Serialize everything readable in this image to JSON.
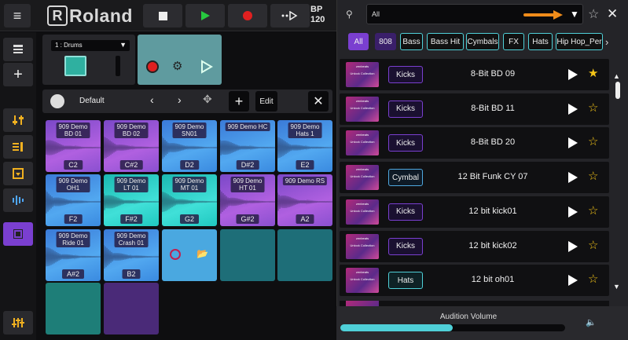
{
  "header": {
    "logo_text": "Roland",
    "logo_mark": "R",
    "bpm_label": "BP",
    "bpm_value": "120"
  },
  "strip": {
    "dropdown_value": "1 : Drums"
  },
  "kit": {
    "name": "Default",
    "edit_label": "Edit"
  },
  "pads": [
    {
      "label": [
        "909 Demo",
        "BD 01"
      ],
      "note": "C2",
      "color": "purple"
    },
    {
      "label": [
        "909 Demo",
        "BD 02"
      ],
      "note": "C#2",
      "color": "purple"
    },
    {
      "label": [
        "909 Demo",
        "SN01"
      ],
      "note": "D2",
      "color": "blue"
    },
    {
      "label": [
        "909 Demo HC"
      ],
      "note": "D#2",
      "color": "blue"
    },
    {
      "label": [
        "909 Demo",
        "Hats 1"
      ],
      "note": "E2",
      "color": "blue"
    },
    {
      "label": [
        "909 Demo",
        "OH1"
      ],
      "note": "F2",
      "color": "blue"
    },
    {
      "label": [
        "909 Demo",
        "LT 01"
      ],
      "note": "F#2",
      "color": "teal"
    },
    {
      "label": [
        "909 Demo",
        "MT 01"
      ],
      "note": "G2",
      "color": "teal"
    },
    {
      "label": [
        "909 Demo",
        "HT 01"
      ],
      "note": "G#2",
      "color": "purple"
    },
    {
      "label": [
        "909 Demo RS"
      ],
      "note": "A2",
      "color": "purple"
    },
    {
      "label": [
        "909 Demo",
        "Ride 01"
      ],
      "note": "A#2",
      "color": "blue"
    },
    {
      "label": [
        "909 Demo",
        "Crash 01"
      ],
      "note": "B2",
      "color": "blue"
    }
  ],
  "browser": {
    "search_value": "All",
    "chips": [
      "All",
      "808",
      "Bass",
      "Bass Hit",
      "Cymbals",
      "FX",
      "Hats",
      "Hip Hop_Per"
    ],
    "thumb_text": [
      "zenbeats",
      "Unlock Collection"
    ],
    "rows": [
      {
        "tag": "Kicks",
        "tag_type": "kicks",
        "name": "8-Bit BD 09",
        "starred": true
      },
      {
        "tag": "Kicks",
        "tag_type": "kicks",
        "name": "8-Bit BD 11",
        "starred": false
      },
      {
        "tag": "Kicks",
        "tag_type": "kicks",
        "name": "8-Bit BD 20",
        "starred": false
      },
      {
        "tag": "Cymbal",
        "tag_type": "cymbal",
        "name": "12 Bit Funk CY 07",
        "starred": false
      },
      {
        "tag": "Kicks",
        "tag_type": "kicks",
        "name": "12 bit kick01",
        "starred": false
      },
      {
        "tag": "Kicks",
        "tag_type": "kicks",
        "name": "12 bit kick02",
        "starred": false
      },
      {
        "tag": "Hats",
        "tag_type": "hats",
        "name": "12 bit oh01",
        "starred": false
      }
    ],
    "volume_label": "Audition Volume",
    "volume_level": 0.5
  },
  "colors": {
    "accent_purple": "#7a3fd0",
    "accent_teal": "#4fd0d8",
    "play_green": "#27c93f",
    "record_red": "#e02020",
    "star_gold": "#f5c518",
    "orange_arrow": "#f08c1a"
  }
}
